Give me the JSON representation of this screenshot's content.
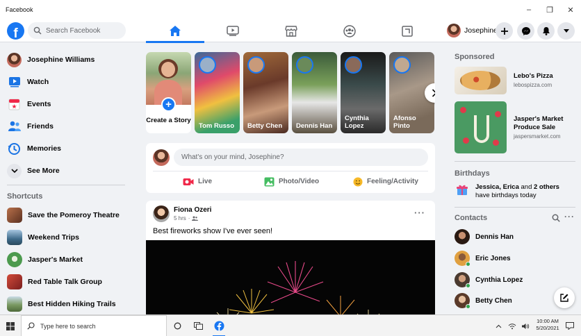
{
  "window": {
    "title": "Facebook",
    "minimize": "–",
    "maximize": "❐",
    "close": "✕"
  },
  "colors": {
    "brand": "#1877f2",
    "online": "#31a24c",
    "bg": "#f0f2f5",
    "text_secondary": "#65676b"
  },
  "header": {
    "search_placeholder": "Search Facebook",
    "tabs": [
      {
        "icon": "home-icon",
        "active": true
      },
      {
        "icon": "watch-icon",
        "active": false
      },
      {
        "icon": "marketplace-icon",
        "active": false
      },
      {
        "icon": "groups-icon",
        "active": false
      },
      {
        "icon": "gaming-icon",
        "active": false
      }
    ],
    "profile_name": "Josephine"
  },
  "sidebar": {
    "items": [
      {
        "label": "Josephine Williams",
        "icon": "avatar"
      },
      {
        "label": "Watch",
        "icon": "watch-icon"
      },
      {
        "label": "Events",
        "icon": "events-icon"
      },
      {
        "label": "Friends",
        "icon": "friends-icon"
      },
      {
        "label": "Memories",
        "icon": "memories-icon"
      },
      {
        "label": "See More",
        "icon": "chevron-down-icon"
      }
    ],
    "shortcuts_title": "Shortcuts",
    "shortcuts": [
      {
        "label": "Save the Pomeroy Theatre",
        "color": "#8a5a3c"
      },
      {
        "label": "Weekend Trips",
        "color": "#4a7a9c"
      },
      {
        "label": "Jasper's Market",
        "color": "#5c9a5a"
      },
      {
        "label": "Red Table Talk Group",
        "color": "#b33a3a"
      },
      {
        "label": "Best Hidden Hiking Trails",
        "color": "#6a8a5a"
      }
    ]
  },
  "stories": {
    "create_label": "Create a Story",
    "items": [
      {
        "name": "Tom Russo"
      },
      {
        "name": "Betty Chen"
      },
      {
        "name": "Dennis Han"
      },
      {
        "name": "Cynthia Lopez"
      },
      {
        "name": "Afonso Pinto"
      }
    ]
  },
  "composer": {
    "placeholder": "What's on your mind, Josephine?",
    "actions": [
      {
        "label": "Live",
        "icon": "live-video-icon",
        "color": "#f02849"
      },
      {
        "label": "Photo/Video",
        "icon": "photo-icon",
        "color": "#45bd62"
      },
      {
        "label": "Feeling/Activity",
        "icon": "feeling-icon",
        "color": "#f7b928"
      }
    ]
  },
  "post": {
    "author": "Fiona Ozeri",
    "time": "5 hrs",
    "text": "Best fireworks show I've ever seen!",
    "more": "···"
  },
  "right": {
    "sponsored_title": "Sponsored",
    "ads": [
      {
        "name": "Lebo's Pizza",
        "url": "lebospizza.com"
      },
      {
        "name": "Jasper's Market Produce Sale",
        "url": "jaspersmarket.com"
      }
    ],
    "birthdays_title": "Birthdays",
    "birthday_names": "Jessica, Erica",
    "birthday_and": " and ",
    "birthday_others": "2 others",
    "birthday_suffix": " have birthdays today",
    "contacts_title": "Contacts",
    "contacts": [
      {
        "name": "Dennis Han",
        "online": false
      },
      {
        "name": "Eric Jones",
        "online": true
      },
      {
        "name": "Cynthia Lopez",
        "online": true
      },
      {
        "name": "Betty Chen",
        "online": true
      }
    ]
  },
  "taskbar": {
    "search_placeholder": "Type here to search",
    "time": "10:00 AM",
    "date": "5/20/2021"
  }
}
